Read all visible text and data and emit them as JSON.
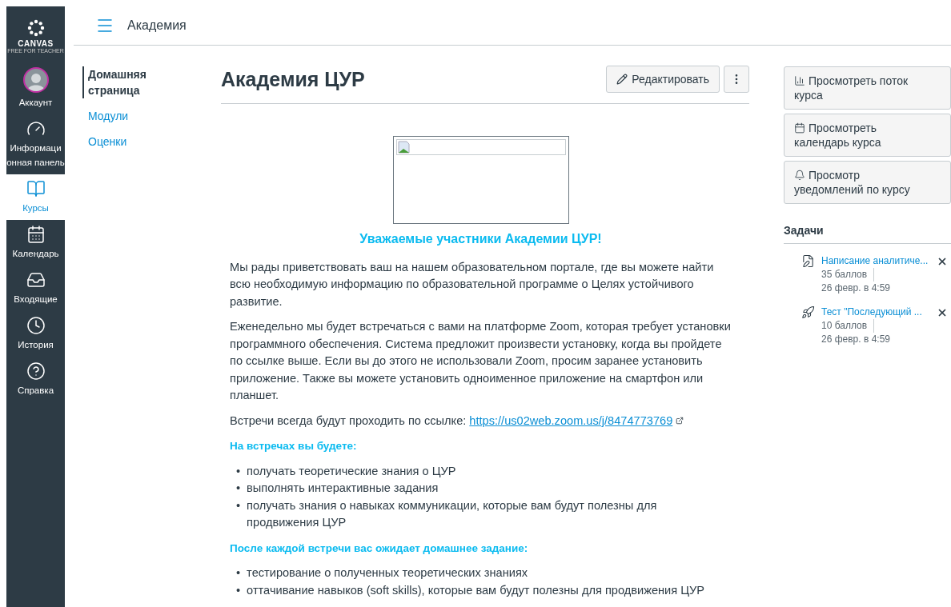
{
  "nav": {
    "logo": {
      "name": "CANVAS",
      "tagline": "FREE FOR TEACHER"
    },
    "items": [
      {
        "kind": "account",
        "label": "Аккаунт",
        "selected": false
      },
      {
        "kind": "dashboard",
        "label": "Информаци онная панель",
        "selected": false
      },
      {
        "kind": "courses",
        "label": "Курсы",
        "selected": true
      },
      {
        "kind": "calendar",
        "label": "Календарь",
        "selected": false
      },
      {
        "kind": "inbox",
        "label": "Входящие",
        "selected": false
      },
      {
        "kind": "history",
        "label": "История",
        "selected": false
      },
      {
        "kind": "help",
        "label": "Справка",
        "selected": false
      }
    ]
  },
  "header": {
    "breadcrumb": "Академия"
  },
  "course_nav": [
    {
      "label": "Домашняя страница",
      "selected": true
    },
    {
      "label": "Модули",
      "selected": false
    },
    {
      "label": "Оценки",
      "selected": false
    }
  ],
  "page": {
    "title": "Академия ЦУР",
    "edit_button": "Редактировать",
    "content": [
      {
        "kind": "image"
      },
      {
        "kind": "heading",
        "text": "Уважаемые участники Академии ЦУР!"
      },
      {
        "kind": "paragraph",
        "text": "Мы рады приветствовать ваш на нашем образовательном портале, где вы можете найти всю необходимую информацию по образовательной программе о Целях устойчивого развитие."
      },
      {
        "kind": "paragraph",
        "text": "Еженедельно мы будет встречаться с вами на платформе Zoom, которая требует установки программного обеспечения. Система предложит произвести установку, когда вы пройдете по ссылке выше. Если вы до этого не использовали Zoom, просим заранее установить приложение. Также вы можете установить одноименное приложение на смартфон или планшет."
      },
      {
        "kind": "link_paragraph",
        "text": "Встречи всегда будут проходить по ссылке:",
        "link": "https://us02web.zoom.us/j/8474773769"
      },
      {
        "kind": "subheading",
        "text": "На встречах вы будете:"
      },
      {
        "kind": "list",
        "marker": "•",
        "items": [
          "получать теоретические знания о ЦУР",
          "выполнять интерактивные задания",
          "получать знания о навыках коммуникации, которые вам будут полезны для продвижения ЦУР"
        ]
      },
      {
        "kind": "subheading",
        "text": "После каждой встречи вас ожидает домашнее задание:"
      },
      {
        "kind": "list",
        "marker": "•",
        "items": [
          "тестирование о полученных теоретических знаниях",
          "оттачивание навыков (soft skills), которые вам будут полезны для продвижения ЦУР"
        ]
      }
    ]
  },
  "sidebar": {
    "buttons": [
      {
        "kind": "stream",
        "label": "Просмотреть поток курса"
      },
      {
        "kind": "calendar",
        "label": "Просмотреть календарь курса"
      },
      {
        "kind": "notifications",
        "label": "Просмотр уведомлений по курсу"
      }
    ],
    "todo": {
      "title": "Задачи",
      "items": [
        {
          "kind": "assignment",
          "title": "Написание аналитиче...",
          "points": "35 баллов",
          "due": "26 февр. в 4:59"
        },
        {
          "kind": "quiz",
          "title": "Тест \"Последующий ...",
          "points": "10 баллов",
          "due": "26 февр. в 4:59"
        }
      ]
    }
  }
}
